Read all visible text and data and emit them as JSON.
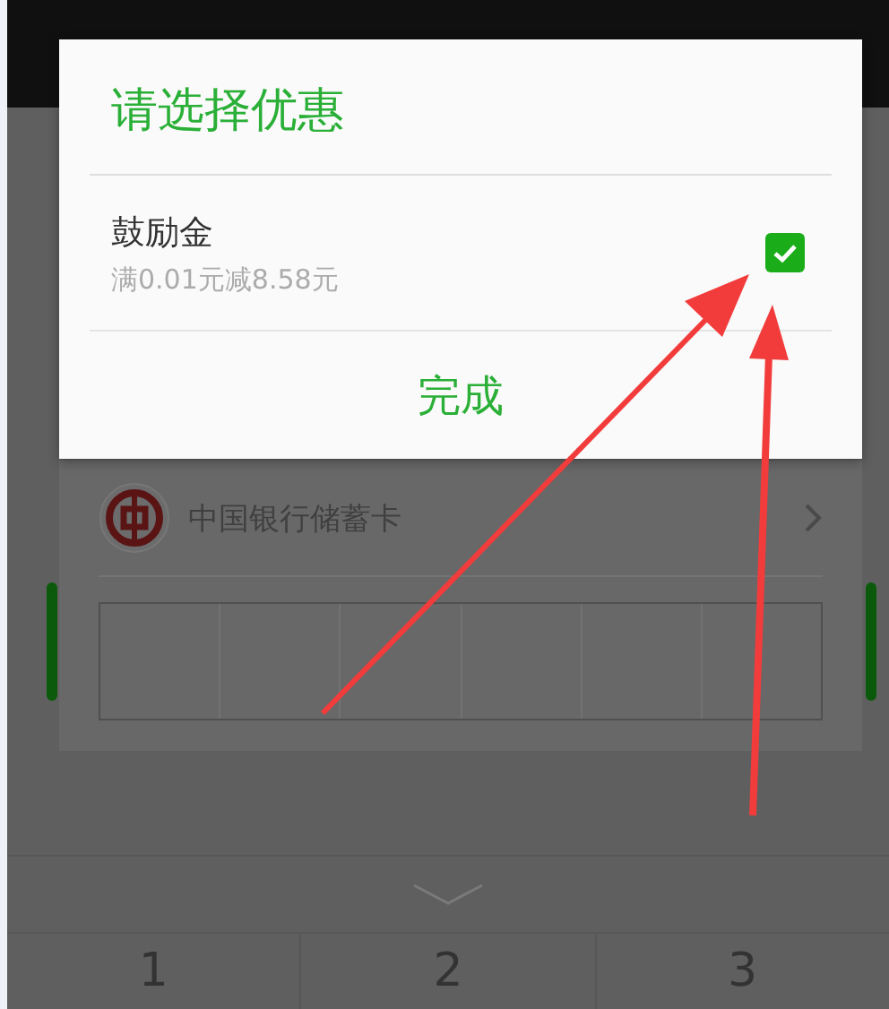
{
  "payment_sheet": {
    "card": {
      "bank_name": "中国银行储蓄卡"
    }
  },
  "keypad": {
    "keys": [
      "1",
      "2",
      "3"
    ]
  },
  "dialog": {
    "title": "请选择优惠",
    "options": [
      {
        "name": "鼓励金",
        "detail": "满0.01元减8.58元",
        "checked": true
      }
    ],
    "confirm_button": "完成"
  }
}
